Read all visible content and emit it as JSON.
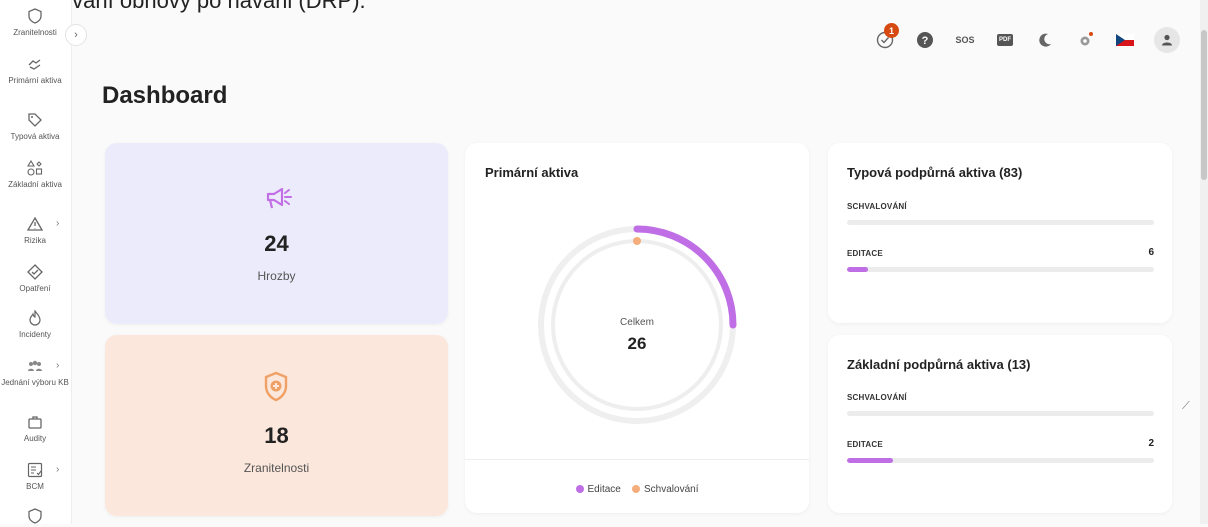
{
  "page_caption": "a plánování obnovy po havárii (DRP).",
  "sidebar": {
    "items": [
      {
        "label": "Zranitelnosti",
        "icon": "shield-icon",
        "arrow": false
      },
      {
        "label": "Primární aktiva",
        "icon": "handshake-icon",
        "arrow": false
      },
      {
        "label": "Typová aktiva",
        "icon": "tag-icon",
        "arrow": false
      },
      {
        "label": "Základní aktiva",
        "icon": "shapes-icon",
        "arrow": false
      },
      {
        "label": "Rizika",
        "icon": "warning-icon",
        "arrow": true
      },
      {
        "label": "Opatření",
        "icon": "diamond-icon",
        "arrow": false
      },
      {
        "label": "Incidenty",
        "icon": "fire-icon",
        "arrow": false
      },
      {
        "label": "Jednání výboru KB",
        "icon": "group-icon",
        "arrow": true
      },
      {
        "label": "Audity",
        "icon": "briefcase-icon",
        "arrow": false
      },
      {
        "label": "BCM",
        "icon": "checklist-icon",
        "arrow": true
      },
      {
        "label": "",
        "icon": "shield-icon",
        "arrow": false
      }
    ]
  },
  "topbar": {
    "notifications_count": "1",
    "sos_label": "SOS",
    "pdf_label": "PDF"
  },
  "page": {
    "title": "Dashboard"
  },
  "cards": {
    "hrozby": {
      "value": "24",
      "label": "Hrozby"
    },
    "zranitelnosti": {
      "value": "18",
      "label": "Zranitelnosti"
    },
    "primarni": {
      "title": "Primární aktiva",
      "center_label": "Celkem",
      "total": "26",
      "legend": [
        {
          "label": "Editace",
          "color": "#bf6ee6"
        },
        {
          "label": "Schvalování",
          "color": "#f5ad7c"
        }
      ],
      "ring": {
        "editace_fraction": 0.25,
        "schvalovani_fraction": 0.0
      }
    },
    "typova": {
      "title": "Typová podpůrná aktiva (83)",
      "rows": [
        {
          "label": "SCHVALOVÁNÍ",
          "value": "",
          "fraction": 0
        },
        {
          "label": "EDITACE",
          "value": "6",
          "fraction": 0.07
        }
      ]
    },
    "zakladni": {
      "title": "Základní podpůrná aktiva (13)",
      "rows": [
        {
          "label": "SCHVALOVÁNÍ",
          "value": "",
          "fraction": 0
        },
        {
          "label": "EDITACE",
          "value": "2",
          "fraction": 0.15
        }
      ]
    }
  },
  "colors": {
    "accent": "#bf6ee6",
    "hrozby_bg": "#ecebfb",
    "zranitelnosti_bg": "#fbe7db",
    "hrozby_icon": "#c26ee6",
    "zranitelnosti_icon": "#f0a065",
    "badge": "#d64a12"
  }
}
